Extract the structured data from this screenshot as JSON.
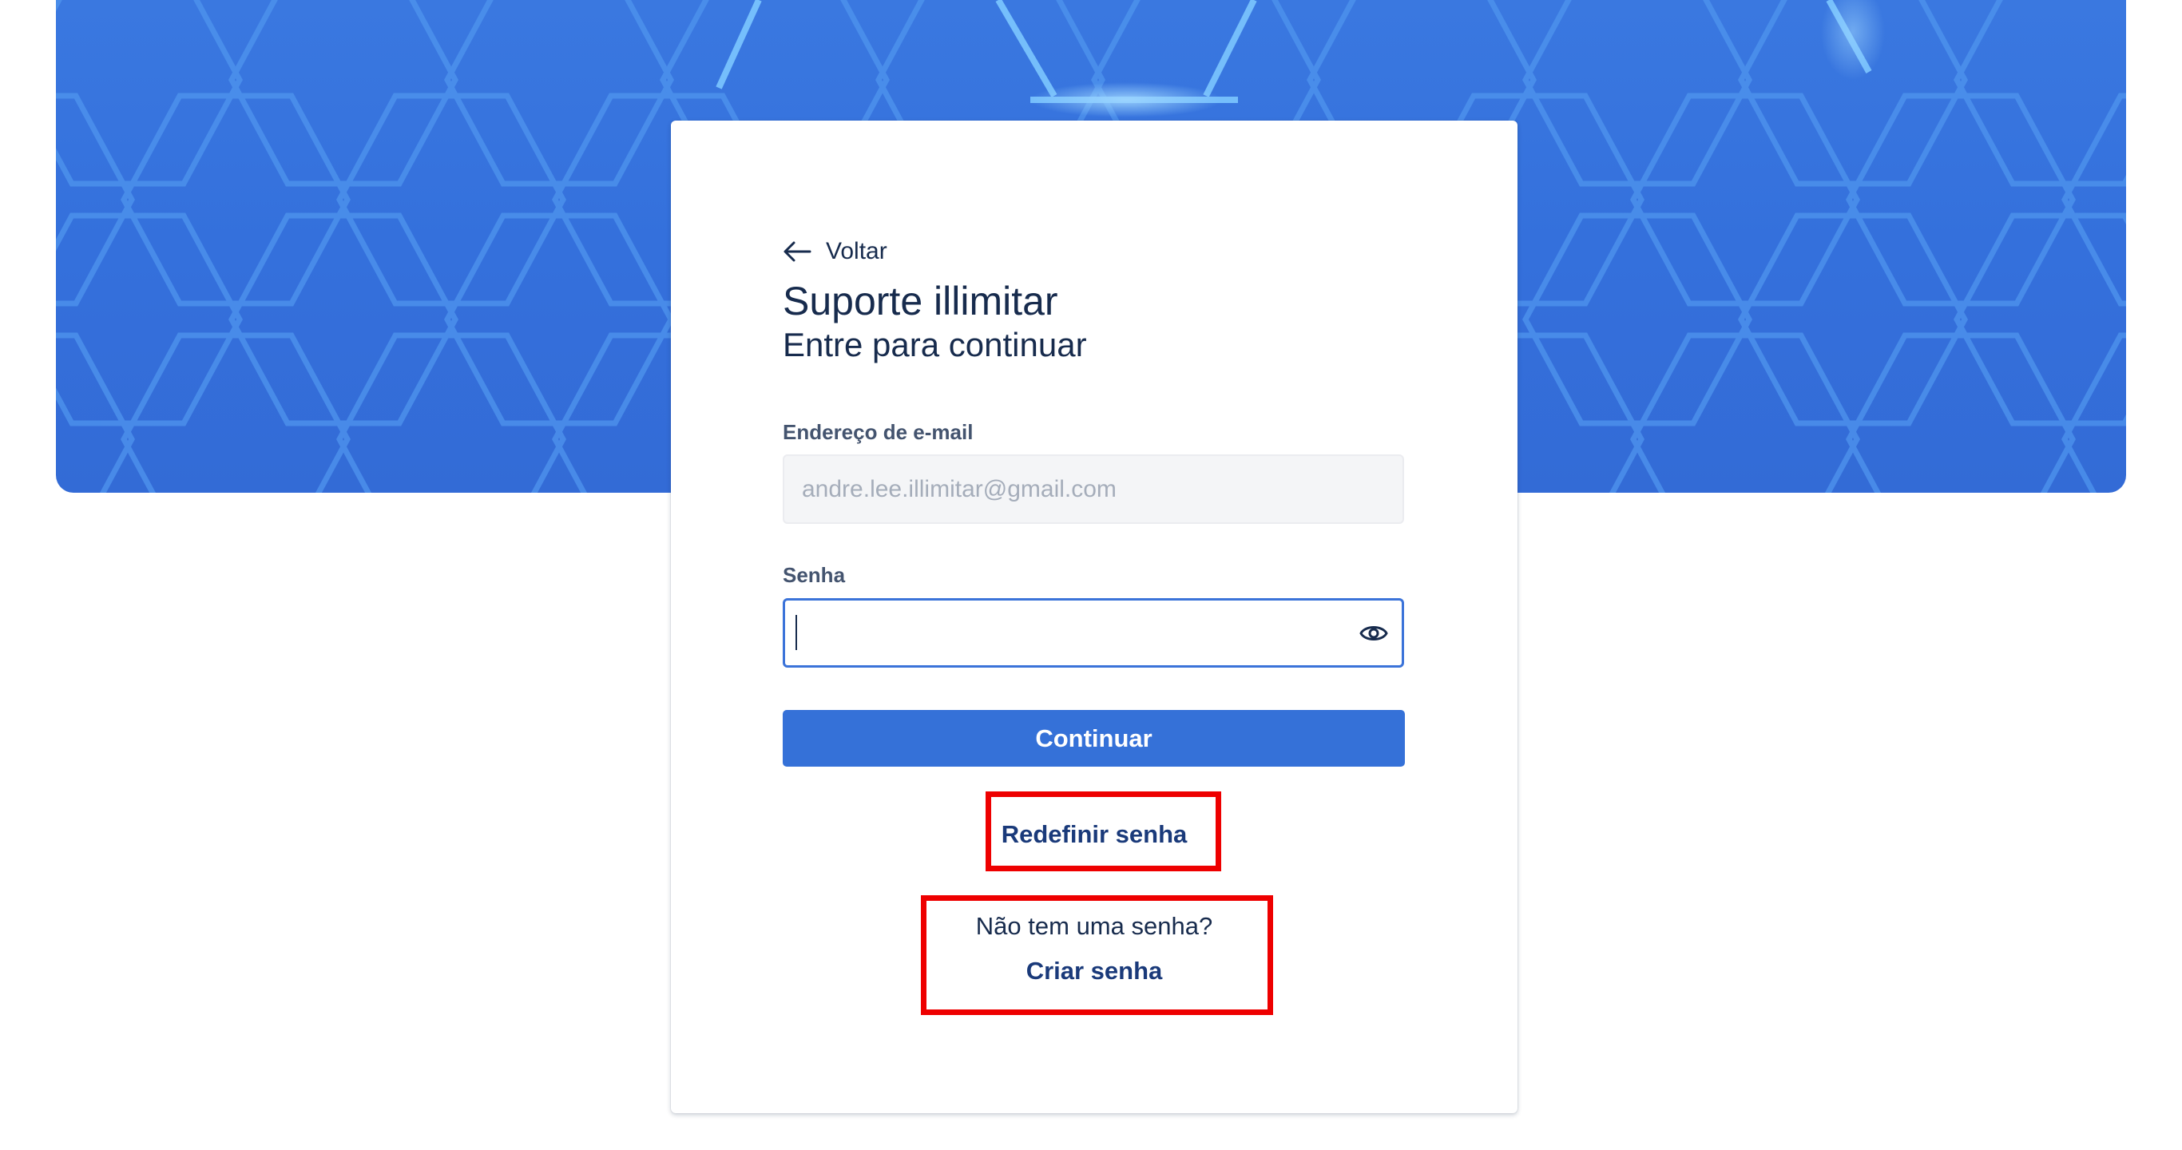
{
  "back": {
    "label": "Voltar",
    "icon": "arrow-left-icon"
  },
  "header": {
    "title": "Suporte illimitar",
    "subtitle": "Entre para continuar"
  },
  "form": {
    "email_label": "Endereço de e-mail",
    "email_value": "andre.lee.illimitar@gmail.com",
    "password_label": "Senha",
    "password_value": "",
    "show_password_icon": "eye-icon",
    "continue_label": "Continuar"
  },
  "links": {
    "reset_password": "Redefinir senha",
    "no_password_text": "Não tem uma senha?",
    "create_password": "Criar senha"
  },
  "colors": {
    "hero_blue": "#3470dc",
    "primary_button": "#3571d8",
    "focus_border": "#3b73d9",
    "highlight_red": "#ee0000",
    "text_dark": "#172b4d"
  }
}
